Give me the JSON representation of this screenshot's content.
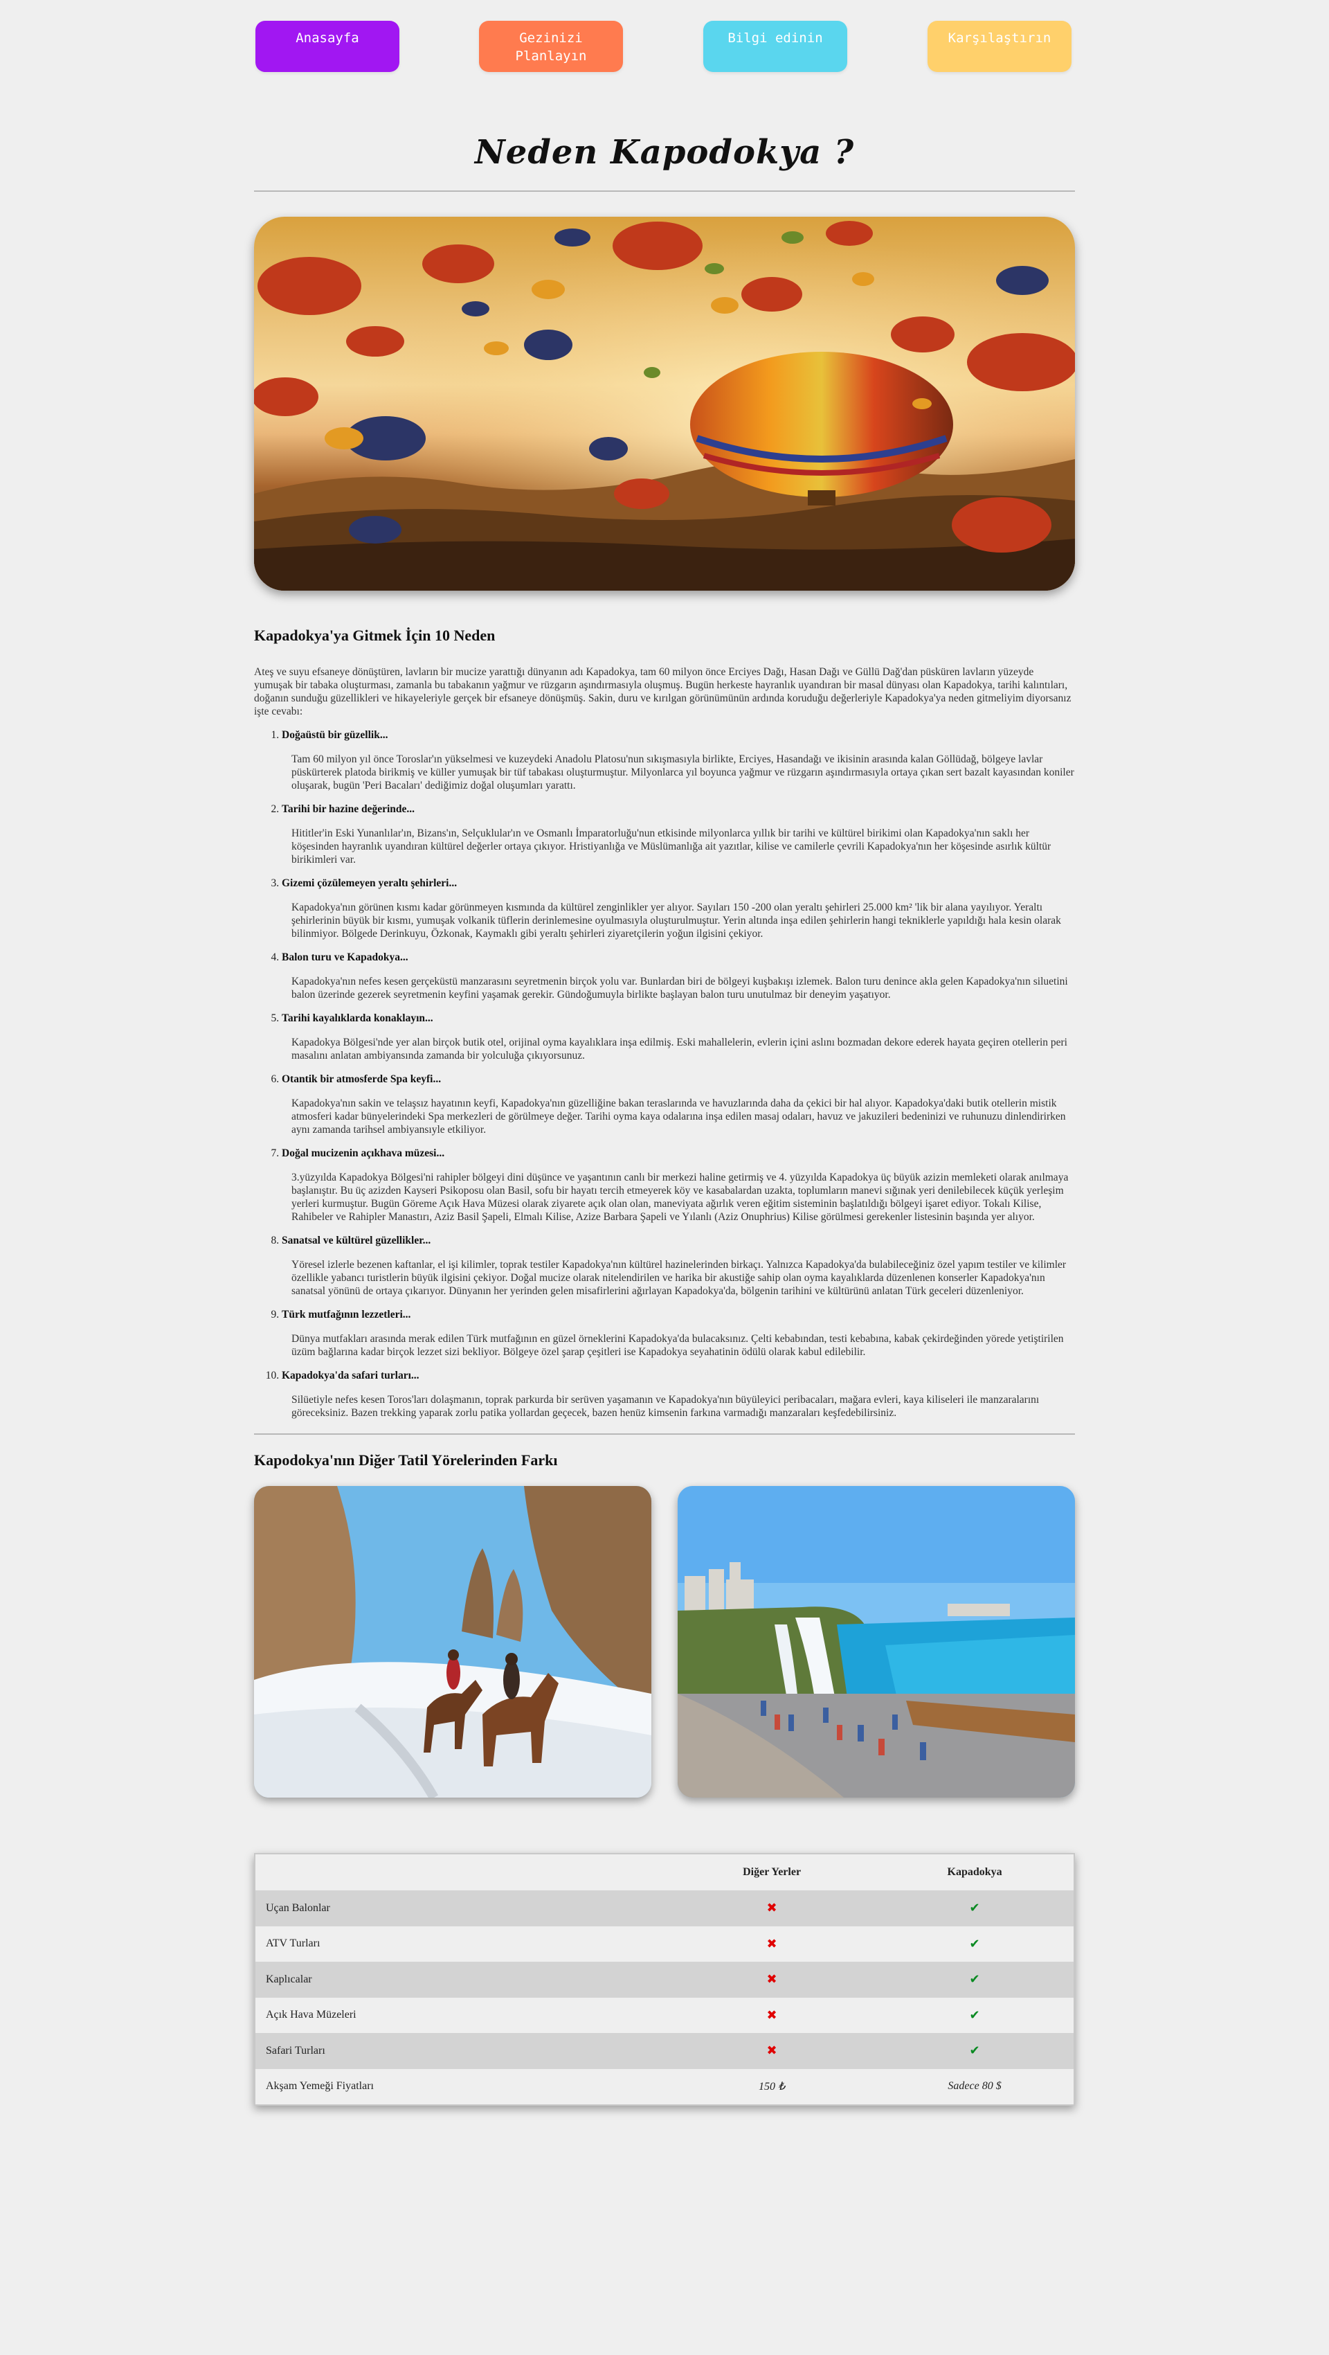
{
  "nav": {
    "items": [
      {
        "label": "Anasayfa",
        "color": "#a117f2"
      },
      {
        "label": "Gezinizi Planlayın",
        "color": "#ff7b4f"
      },
      {
        "label": "Bilgi edinin",
        "color": "#5ad6ee"
      },
      {
        "label": "Karşılaştırın",
        "color": "#ffd06b"
      }
    ]
  },
  "page_title": "Neden Kapodokya ?",
  "hero": {
    "icon": "hot-air-balloons-image"
  },
  "article": {
    "heading": "Kapadokya'ya Gitmek İçin 10 Neden",
    "intro": "Ateş ve suyu efsaneye dönüştüren, lavların bir mucize yarattığı dünyanın adı Kapadokya, tam 60 milyon önce Erciyes Dağı, Hasan Dağı ve Güllü Dağ'dan püsküren lavların yüzeyde yumuşak bir tabaka oluşturması, zamanla bu tabakanın yağmur ve rüzgarın aşındırmasıyla oluşmuş. Bugün herkeste hayranlık uyandıran bir masal dünyası olan Kapadokya, tarihi kalıntıları, doğanın sunduğu güzellikleri ve hikayeleriyle gerçek bir efsaneye dönüşmüş. Sakin, duru ve kırılgan görünümünün ardında koruduğu değerleriyle Kapadokya'ya neden gitmeliyim diyorsanız işte cevabı:",
    "reasons": [
      {
        "title": "Doğaüstü bir güzellik...",
        "text": "Tam 60 milyon yıl önce Toroslar'ın yükselmesi ve kuzeydeki Anadolu Platosu'nun sıkışmasıyla birlikte, Erciyes, Hasandağı ve ikisinin arasında kalan Göllüdağ, bölgeye lavlar püskürterek platoda birikmiş ve küller yumuşak bir tüf tabakası oluşturmuştur. Milyonlarca yıl boyunca yağmur ve rüzgarın aşındırmasıyla ortaya çıkan sert bazalt kayasından koniler oluşarak, bugün 'Peri Bacaları' dediğimiz doğal oluşumları yarattı."
      },
      {
        "title": "Tarihi bir hazine değerinde...",
        "text": "Hititler'in Eski Yunanlılar'ın, Bizans'ın, Selçuklular'ın ve Osmanlı İmparatorluğu'nun etkisinde milyonlarca yıllık bir tarihi ve kültürel birikimi olan Kapadokya'nın saklı her köşesinden hayranlık uyandıran kültürel değerler ortaya çıkıyor. Hristiyanlığa ve Müslümanlığa ait yazıtlar, kilise ve camilerle çevrili Kapadokya'nın her köşesinde asırlık kültür birikimleri var."
      },
      {
        "title": "Gizemi çözülemeyen yeraltı şehirleri...",
        "text": "Kapadokya'nın görünen kısmı kadar görünmeyen kısmında da kültürel zenginlikler yer alıyor. Sayıları 150 -200 olan yeraltı şehirleri 25.000 km² 'lik bir alana yayılıyor. Yeraltı şehirlerinin büyük bir kısmı, yumuşak volkanik tüflerin derinlemesine oyulmasıyla oluşturulmuştur. Yerin altında inşa edilen şehirlerin hangi tekniklerle yapıldığı hala kesin olarak bilinmiyor. Bölgede Derinkuyu, Özkonak, Kaymaklı gibi yeraltı şehirleri ziyaretçilerin yoğun ilgisini çekiyor."
      },
      {
        "title": "Balon turu ve Kapadokya...",
        "text": "Kapadokya'nın nefes kesen gerçeküstü manzarasını seyretmenin birçok yolu var. Bunlardan biri de bölgeyi kuşbakışı izlemek. Balon turu denince akla gelen Kapadokya'nın siluetini balon üzerinde gezerek seyretmenin keyfini yaşamak gerekir. Gündoğumuyla birlikte başlayan balon turu unutulmaz bir deneyim yaşatıyor."
      },
      {
        "title": "Tarihi kayalıklarda konaklayın...",
        "text": "Kapadokya Bölgesi'nde yer alan birçok butik otel, orijinal oyma kayalıklara inşa edilmiş. Eski mahallelerin, evlerin içini aslını bozmadan dekore ederek hayata geçiren otellerin peri masalını anlatan ambiyansında zamanda bir yolculuğa çıkıyorsunuz."
      },
      {
        "title": "Otantik bir atmosferde Spa keyfi...",
        "text": "Kapadokya'nın sakin ve telaşsız hayatının keyfi, Kapadokya'nın güzelliğine bakan teraslarında ve havuzlarında daha da çekici bir hal alıyor. Kapadokya'daki butik otellerin mistik atmosferi kadar bünyelerindeki Spa merkezleri de görülmeye değer. Tarihi oyma kaya odalarına inşa edilen masaj odaları, havuz ve jakuzileri bedeninizi ve ruhunuzu dinlendirirken aynı zamanda tarihsel ambiyansıyle etkiliyor."
      },
      {
        "title": "Doğal mucizenin açıkhava müzesi...",
        "text": "3.yüzyılda Kapadokya Bölgesi'ni rahipler bölgeyi dini düşünce ve yaşantının canlı bir merkezi haline getirmiş ve 4. yüzyılda Kapadokya üç büyük azizin memleketi olarak anılmaya başlanıştır. Bu üç azizden Kayseri Psikoposu olan Basil, sofu bir hayatı tercih etmeyerek köy ve kasabalardan uzakta, toplumların manevi sığınak yeri denilebilecek küçük yerleşim yerleri kurmuştur. Bugün Göreme Açık Hava Müzesi olarak ziyarete açık olan olan, maneviyata ağırlık veren eğitim sisteminin başlatıldığı bölgeyi işaret ediyor. Tokalı Kilise, Rahibeler ve Rahipler Manastırı, Aziz Basil Şapeli, Elmalı Kilise, Azize Barbara Şapeli ve Yılanlı (Aziz Onuphrius) Kilise görülmesi gerekenler listesinin başında yer alıyor."
      },
      {
        "title": "Sanatsal ve kültürel güzellikler...",
        "text": "Yöresel izlerle bezenen kaftanlar, el işi kilimler, toprak testiler Kapadokya'nın kültürel hazinelerinden birkaçı. Yalnızca Kapadokya'da bulabileceğiniz özel yapım testiler ve kilimler özellikle yabancı turistlerin büyük ilgisini çekiyor. Doğal mucize olarak nitelendirilen ve harika bir akustiğe sahip olan oyma kayalıklarda düzenlenen konserler Kapadokya'nın sanatsal yönünü de ortaya çıkarıyor. Dünyanın her yerinden gelen misafirlerini ağırlayan Kapadokya'da, bölgenin tarihini ve kültürünü anlatan Türk geceleri düzenleniyor."
      },
      {
        "title": "Türk mutfağının lezzetleri...",
        "text": "Dünya mutfakları arasında merak edilen Türk mutfağının en güzel örneklerini Kapadokya'da bulacaksınız. Çelti kebabından, testi kebabına, kabak çekirdeğinden yörede yetiştirilen üzüm bağlarına kadar birçok lezzet sizi bekliyor. Bölgeye özel şarap çeşitleri ise Kapadokya seyahatinin ödülü olarak kabul edilebilir."
      },
      {
        "title": "Kapadokya'da safari turları...",
        "text": "Silüetiyle nefes kesen Toros'ları dolaşmanın, toprak parkurda bir serüven yaşamanın ve Kapadokya'nın büyüleyici peribacaları, mağara evleri, kaya kiliseleri ile manzaralarını göreceksiniz. Bazen trekking yaparak zorlu patika yollardan geçecek, bazen henüz kimsenin farkına varmadığı manzaraları keşfedebilirsiniz."
      }
    ]
  },
  "compare": {
    "heading": "Kapodokya'nın Diğer Tatil Yörelerinden Farkı",
    "photos": [
      {
        "icon": "snowy-horse-riding-image"
      },
      {
        "icon": "waterfall-coast-image"
      }
    ],
    "table": {
      "headers": [
        "",
        "Diğer Yerler",
        "Kapadokya"
      ],
      "rows": [
        {
          "feature": "Uçan Balonlar",
          "other": "✖",
          "kapadokya": "✔"
        },
        {
          "feature": "ATV Turları",
          "other": "✖",
          "kapadokya": "✔"
        },
        {
          "feature": "Kaplıcalar",
          "other": "✖",
          "kapadokya": "✔"
        },
        {
          "feature": "Açık Hava Müzeleri",
          "other": "✖",
          "kapadokya": "✔"
        },
        {
          "feature": "Safari Turları",
          "other": "✖",
          "kapadokya": "✔"
        },
        {
          "feature": "Akşam Yemeği Fiyatları",
          "other": "150 ₺",
          "kapadokya": "Sadece 80 $"
        }
      ],
      "colors": {
        "cross": "#e00000",
        "check": "#0a8a22"
      }
    }
  }
}
